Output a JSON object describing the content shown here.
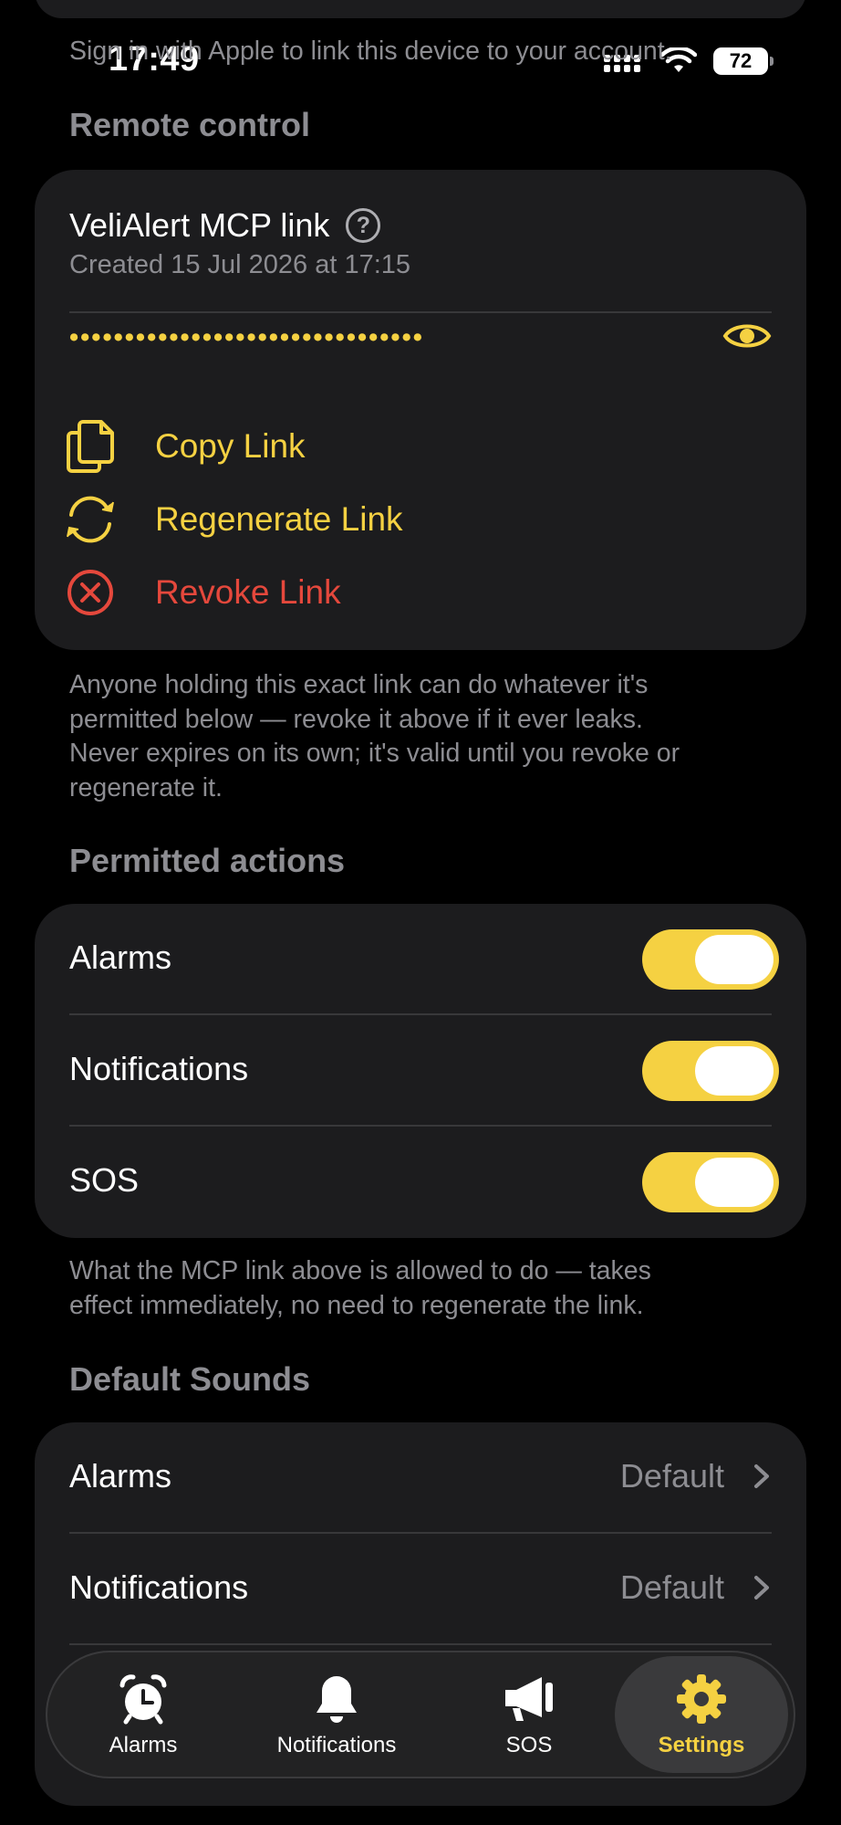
{
  "status_bar": {
    "time": "17:49",
    "battery": "72"
  },
  "top_note": "Sign in with Apple to link this device to your account.",
  "remote_control": {
    "header": "Remote control",
    "link_title": "VeliAlert MCP link",
    "created": "Created 15 Jul 2026 at 17:15",
    "masked_link": "••••••••••••••••••••••••••••••••",
    "actions": {
      "copy": "Copy Link",
      "regenerate": "Regenerate Link",
      "revoke": "Revoke Link"
    },
    "footnote": [
      "Anyone holding this exact link can do whatever it's",
      "permitted below — revoke it above if it ever leaks.",
      "Never expires on its own; it's valid until you revoke or",
      "regenerate it."
    ]
  },
  "permitted_actions": {
    "header": "Permitted actions",
    "items": [
      {
        "label": "Alarms",
        "enabled": true
      },
      {
        "label": "Notifications",
        "enabled": true
      },
      {
        "label": "SOS",
        "enabled": true
      }
    ],
    "footnote": [
      "What the MCP link above is allowed to do — takes",
      "effect immediately, no need to regenerate the link."
    ]
  },
  "default_sounds": {
    "header": "Default Sounds",
    "items": [
      {
        "label": "Alarms",
        "value": "Default"
      },
      {
        "label": "Notifications",
        "value": "Default"
      }
    ]
  },
  "tabbar": {
    "tabs": [
      {
        "label": "Alarms",
        "icon": "alarm-clock-icon"
      },
      {
        "label": "Notifications",
        "icon": "bell-icon"
      },
      {
        "label": "SOS",
        "icon": "megaphone-icon"
      },
      {
        "label": "Settings",
        "icon": "gear-icon",
        "active": true
      }
    ]
  },
  "colors": {
    "accent": "#f5d142",
    "destructive": "#e5483c",
    "card": "#1c1c1e",
    "secondary_text": "#8d8d92"
  }
}
